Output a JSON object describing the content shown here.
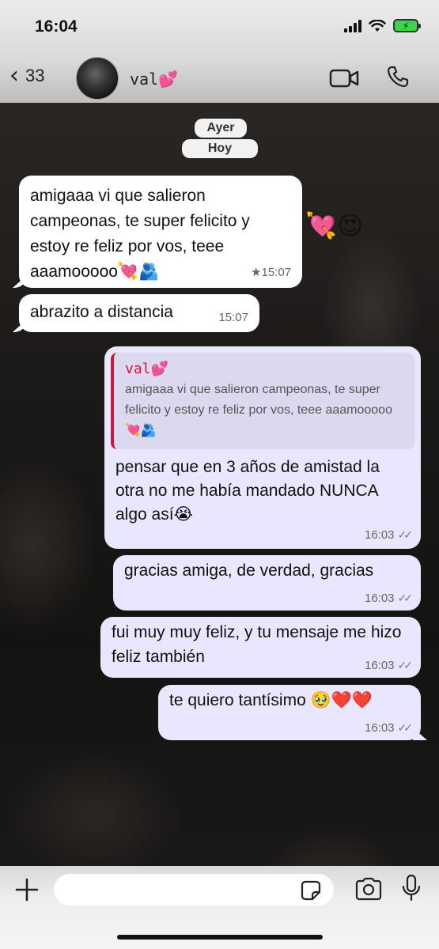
{
  "status_bar": {
    "time": "16:04"
  },
  "header": {
    "back_count": "33",
    "contact_name": "val💕"
  },
  "date_chips": {
    "yesterday": "Ayer",
    "today": "Hoy"
  },
  "messages": [
    {
      "direction": "incoming",
      "text": "amigaaa vi que salieron campeonas, te super felicito y estoy re feliz por vos, teee aaamooooo💘🫂",
      "time": "★15:07",
      "reactions": "💘😍"
    },
    {
      "direction": "incoming",
      "text": "abrazito a distancia",
      "time": "15:07"
    },
    {
      "direction": "outgoing",
      "quote_name": "val💕",
      "quote_text": "amigaaa vi que salieron campeonas, te super felicito y estoy re feliz por vos, teee aaamooooo💘🫂",
      "text": "pensar que en 3 años de amistad la otra no me había mandado NUNCA algo así😭",
      "time": "16:03"
    },
    {
      "direction": "outgoing",
      "text": "gracias amiga, de verdad, gracias",
      "time": "16:03"
    },
    {
      "direction": "outgoing",
      "text": "fui muy muy feliz, y tu mensaje me hizo feliz también",
      "time": "16:03"
    },
    {
      "direction": "outgoing",
      "text": "te quiero tantísimo 🥹❤️❤️",
      "time": "16:03"
    }
  ],
  "composer": {
    "input_value": "",
    "placeholder": ""
  },
  "colors": {
    "incoming_bubble": "#ffffff",
    "outgoing_bubble": "#e9e6ff",
    "quote_accent": "#d0143c",
    "battery_green": "#3fd34a"
  },
  "icons": [
    "back-chevron-icon",
    "video-call-icon",
    "phone-call-icon",
    "plus-icon",
    "sticker-icon",
    "camera-icon",
    "microphone-icon",
    "signal-icon",
    "wifi-icon",
    "battery-icon",
    "read-receipt-icon"
  ]
}
